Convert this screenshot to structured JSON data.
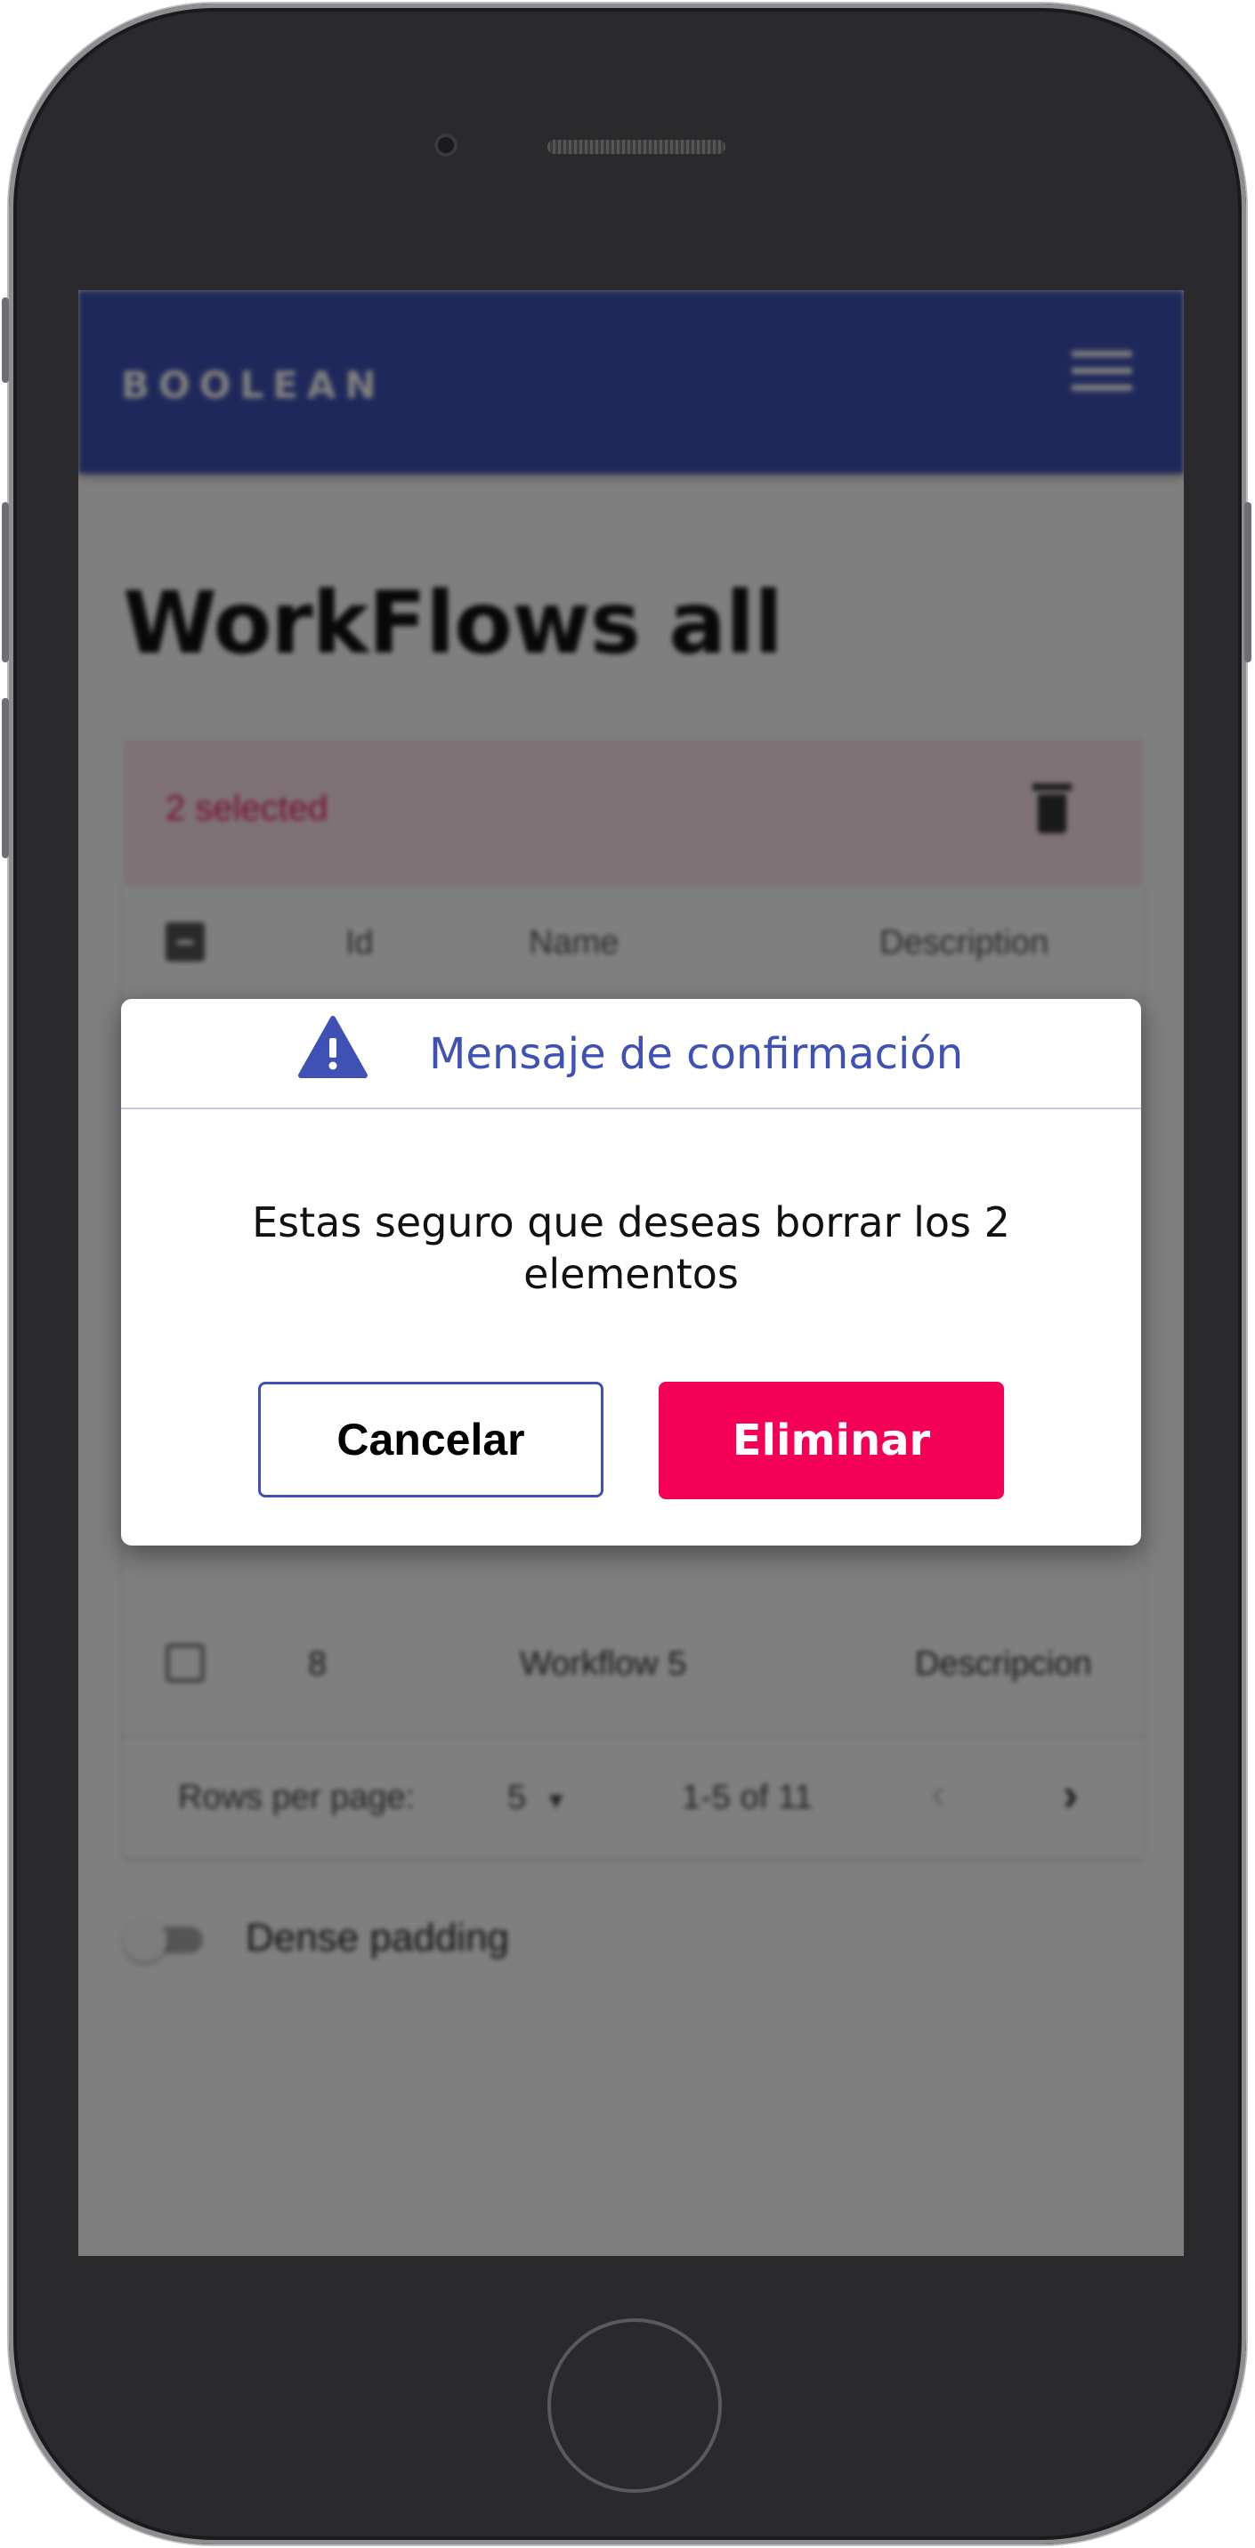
{
  "app": {
    "logo": "BOOLEAN",
    "menu_icon": "hamburger-menu-icon"
  },
  "page": {
    "title": "WorkFlows all"
  },
  "selection": {
    "text": "2 selected",
    "delete_icon": "trash-icon"
  },
  "table": {
    "columns": [
      "Id",
      "Name",
      "Description"
    ],
    "rows": [
      {
        "id": "8",
        "name": "Workflow 5",
        "description": "Descripcion"
      }
    ]
  },
  "pagination": {
    "rows_per_page_label": "Rows per page:",
    "rows_per_page_value": "5",
    "range": "1-5 of 11",
    "prev_icon": "chevron-left-icon",
    "next_icon": "chevron-right-icon"
  },
  "dense_toggle": {
    "label": "Dense padding",
    "checked": false
  },
  "dialog": {
    "icon": "warning-icon",
    "title": "Mensaje de confirmación",
    "message": "Estas seguro que deseas borrar los 2 elementos",
    "cancel_label": "Cancelar",
    "delete_label": "Eliminar"
  },
  "colors": {
    "primary": "#3f51b5",
    "danger": "#f50057",
    "selection_bg": "#fde4ec",
    "selection_text": "#e91e63"
  }
}
